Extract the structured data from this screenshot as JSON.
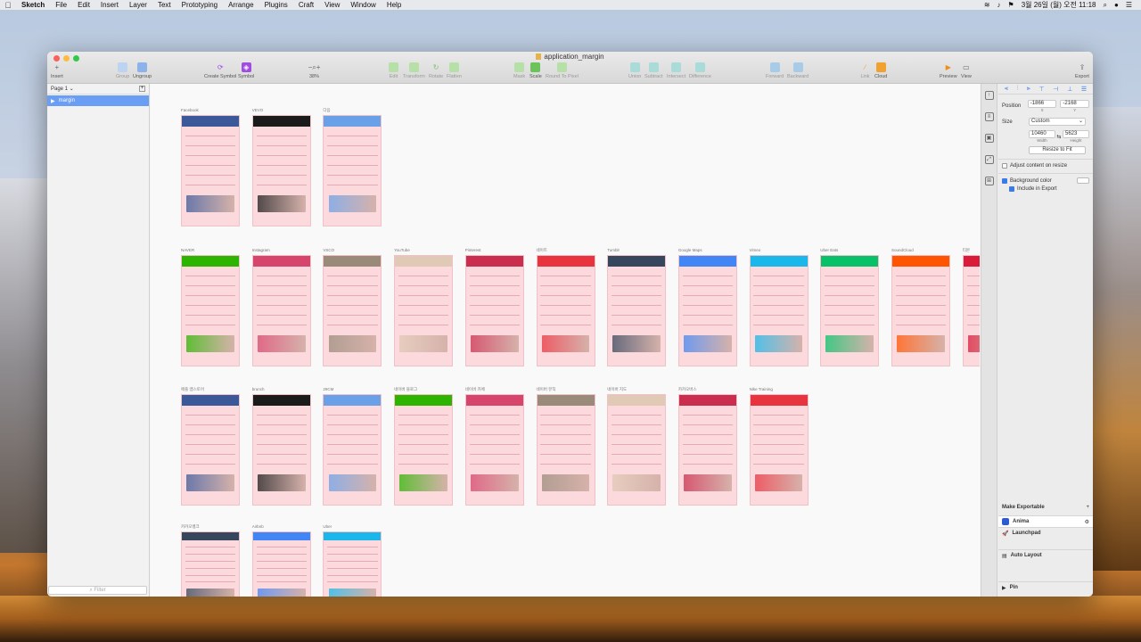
{
  "menubar": {
    "apple": "",
    "items": [
      "Sketch",
      "File",
      "Edit",
      "Insert",
      "Layer",
      "Text",
      "Prototyping",
      "Arrange",
      "Plugins",
      "Craft",
      "View",
      "Window",
      "Help"
    ],
    "clock": "3월 26일 (월) 오전 11:18"
  },
  "window": {
    "title": "application_margin",
    "toolbar": {
      "insert": "Insert",
      "group": "Group",
      "ungroup": "Ungroup",
      "create_symbol": "Create Symbol",
      "symbol": "Symbol",
      "zoom": "38%",
      "edit": "Edit",
      "transform": "Transform",
      "rotate": "Rotate",
      "flatten": "Flatten",
      "mask": "Mask",
      "scale": "Scale",
      "round": "Round To Pixel",
      "union": "Union",
      "subtract": "Subtract",
      "intersect": "Intersect",
      "difference": "Difference",
      "forward": "Forward",
      "backward": "Backward",
      "link": "Link",
      "cloud": "Cloud",
      "preview": "Preview",
      "view": "View",
      "export": "Export"
    }
  },
  "layers": {
    "page": "Page 1",
    "selected_layer": "margin",
    "filter_placeholder": "Filter"
  },
  "artboards": [
    {
      "label": "Facebook"
    },
    {
      "label": "VEVO"
    },
    {
      "label": "다음"
    },
    {
      "label": "NAVER"
    },
    {
      "label": "Instagram"
    },
    {
      "label": "VSCO"
    },
    {
      "label": "YouTube"
    },
    {
      "label": "Pinterest"
    },
    {
      "label": "네이트"
    },
    {
      "label": "Tumblr"
    },
    {
      "label": "Google Maps"
    },
    {
      "label": "Vimeo"
    },
    {
      "label": "Uber Eats"
    },
    {
      "label": "SoundCloud"
    },
    {
      "label": "티몬"
    },
    {
      "label": "애플 앱스토어"
    },
    {
      "label": "brunch"
    },
    {
      "label": "29CM"
    },
    {
      "label": "네이버 블로그"
    },
    {
      "label": "네이버 카페"
    },
    {
      "label": "네이버 뮤직"
    },
    {
      "label": "네이버 지도"
    },
    {
      "label": "카카오버스"
    },
    {
      "label": "Nike Training"
    },
    {
      "label": "카카오뱅크"
    },
    {
      "label": "Airbnb"
    },
    {
      "label": "Uber"
    }
  ],
  "inspector": {
    "position_label": "Position",
    "x": "-1866",
    "y": "-2168",
    "x_cap": "X",
    "y_cap": "Y",
    "size_label": "Size",
    "size_preset": "Custom",
    "width": "10460",
    "height": "5623",
    "w_cap": "Width",
    "h_cap": "Height",
    "resize_btn": "Resize to Fit",
    "adjust": "Adjust content on resize",
    "bg_color": "Background color",
    "include_export": "Include in Export",
    "make_exportable": "Make Exportable",
    "plugins": [
      "Anima",
      "Launchpad",
      "Auto Layout",
      "Pin"
    ]
  }
}
